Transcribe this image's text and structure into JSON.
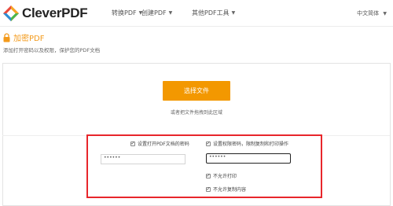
{
  "header": {
    "logo_text": "CleverPDF",
    "nav": [
      {
        "label": "转换PDF"
      },
      {
        "label": "创建PDF"
      },
      {
        "label": "其他PDF工具"
      }
    ],
    "language": "中文简体"
  },
  "page": {
    "title": "加密PDF",
    "subtitle": "添加打开密码以及权限，保护您的PDF文档"
  },
  "upload": {
    "button_label": "选择文件",
    "drop_hint": "或者把文件拖拽到此区域"
  },
  "options": {
    "open_password": {
      "checked": true,
      "label": "设置打开PDF文档的密码",
      "value": "••••••"
    },
    "permission_password": {
      "checked": true,
      "label": "设置权限密码，限制复制和打印操作",
      "value": "••••••"
    },
    "no_print": {
      "checked": true,
      "label": "不允许打印"
    },
    "no_copy": {
      "checked": true,
      "label": "不允许复制内容"
    }
  },
  "colors": {
    "accent": "#f39800",
    "title": "#f39a1b",
    "highlight": "#e8262b"
  }
}
